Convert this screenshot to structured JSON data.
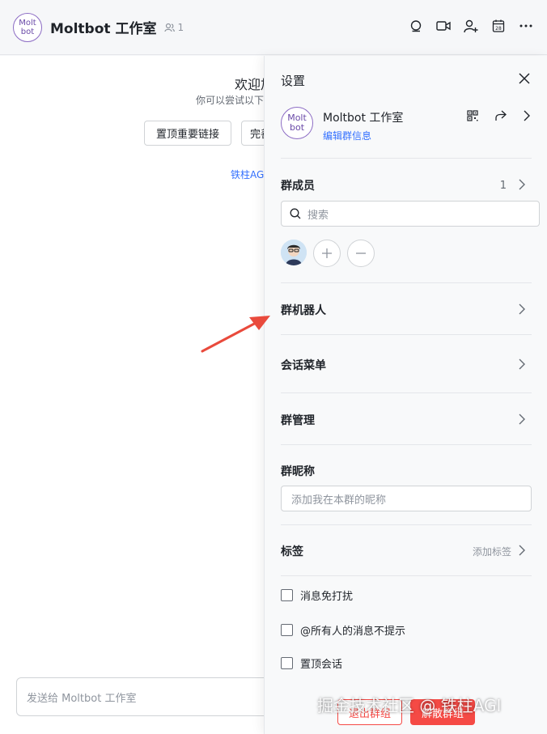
{
  "header": {
    "logo_line1": "Molt",
    "logo_line2": "bot",
    "title": "Moltbot 工作室",
    "member_count": "1",
    "icons": [
      "search-icon",
      "video-icon",
      "add-member-icon",
      "calendar-icon",
      "more-icon"
    ]
  },
  "chat": {
    "welcome": "欢迎加",
    "welcome_sub": "你可以尝试以下",
    "chip_pin_link": "置顶重要链接",
    "chip_complete": "完善",
    "link_text": "铁柱AGI",
    "composer_placeholder": "发送给 Moltbot 工作室"
  },
  "panel": {
    "title": "设置",
    "group_name": "Moltbot 工作室",
    "edit_group_info": "编辑群信息",
    "members_label": "群成员",
    "members_count": "1",
    "search_placeholder": "搜索",
    "bots_label": "群机器人",
    "session_menu_label": "会话菜单",
    "group_manage_label": "群管理",
    "nickname_label": "群昵称",
    "nickname_placeholder": "添加我在本群的昵称",
    "tags_label": "标签",
    "add_tags": "添加标签",
    "mute_label": "消息免打扰",
    "at_all_label": "@所有人的消息不提示",
    "pin_chat_label": "置顶会话",
    "exit_button": "退出群组",
    "disband_button": "解散群组"
  },
  "watermark": "掘金技术社区 @ 铁柱AGI",
  "colors": {
    "accent_blue": "#3370ff",
    "danger_red": "#f54a45",
    "arrow_red": "#e94a3c",
    "logo_purple": "#8c6cc4"
  }
}
